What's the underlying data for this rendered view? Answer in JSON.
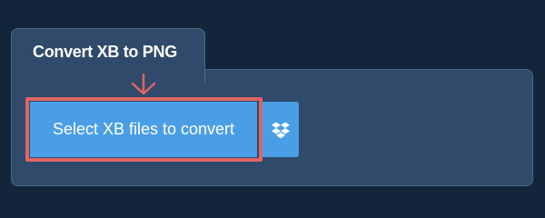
{
  "converter": {
    "tab_title": "Convert XB to PNG",
    "select_label": "Select XB files to convert",
    "icons": {
      "arrow": "arrow-down-icon",
      "dropbox": "dropbox-icon"
    },
    "colors": {
      "background": "#13253a",
      "panel": "#2f4a6a",
      "button": "#4a9ee6",
      "highlight": "#e06464"
    }
  }
}
